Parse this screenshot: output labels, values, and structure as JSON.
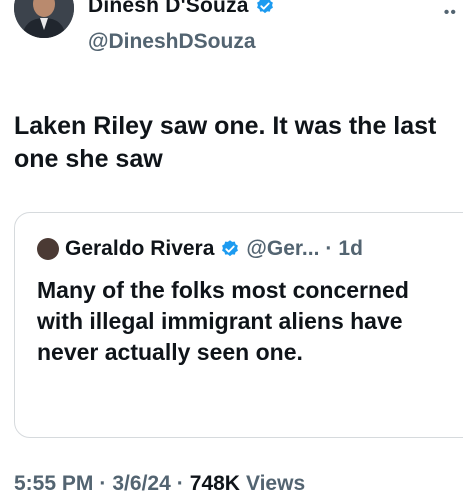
{
  "author": {
    "name": "Dinesh D'Souza",
    "handle": "@DineshDSouza",
    "verified_color": "#1d9bf0"
  },
  "tweet": {
    "text": "Laken Riley saw one. It was the last one she saw"
  },
  "quoted": {
    "name": "Geraldo Rivera",
    "handle": "@Ger...",
    "separator": "·",
    "time": "1d",
    "text": "Many of the folks most concerned with illegal immigrant aliens have never actually seen one."
  },
  "meta": {
    "time": "5:55 PM",
    "sep1": "·",
    "date": "3/6/24",
    "sep2": "·",
    "views_count": "748K",
    "views_label": "Views"
  },
  "icons": {
    "more": "more-icon",
    "verified": "verified-badge-icon"
  }
}
